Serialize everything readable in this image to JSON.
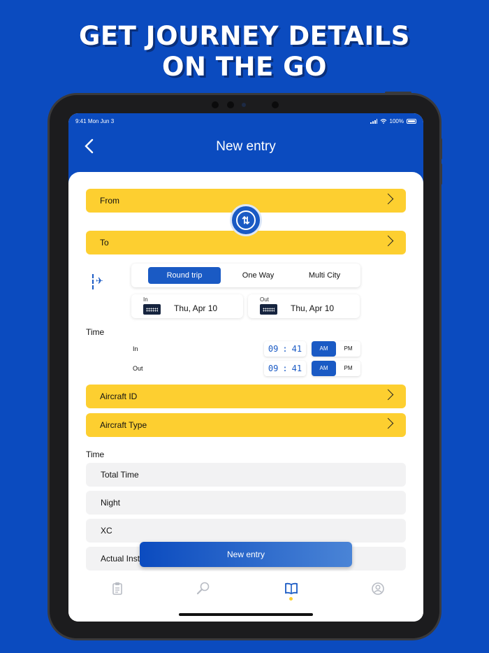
{
  "headline": {
    "line1": "GET JOURNEY DETAILS",
    "line2": "ON THE GO"
  },
  "status_bar": {
    "time": "9:41",
    "date": "Mon Jun 3",
    "battery": "100%"
  },
  "nav": {
    "title": "New entry",
    "back_icon": "chevron-left-icon"
  },
  "route": {
    "from_label": "From",
    "to_label": "To",
    "swap_icon": "swap-arrows-icon",
    "plane_icon": "plane-icon"
  },
  "trip_type": {
    "options": [
      "Round trip",
      "One Way",
      "Multi City"
    ],
    "selected": "Round trip"
  },
  "dates": {
    "in_label": "In",
    "in_value": "Thu, Apr 10",
    "out_label": "Out",
    "out_value": "Thu, Apr 10"
  },
  "time_section": {
    "label": "Time",
    "in_label": "In",
    "in_hour": "09",
    "in_minute": "41",
    "out_label": "Out",
    "out_hour": "09",
    "out_minute": "41",
    "separator": ":",
    "am": "AM",
    "pm": "PM",
    "in_period": "AM",
    "out_period": "AM"
  },
  "aircraft": {
    "id_label": "Aircraft ID",
    "type_label": "Aircraft Type"
  },
  "time_totals": {
    "label": "Time",
    "rows": [
      "Total Time",
      "Night",
      "XC",
      "Actual Inst"
    ]
  },
  "fab_label": "New entry",
  "tabs": [
    {
      "name": "logbook-tab",
      "icon": "clipboard-icon"
    },
    {
      "name": "search-tab",
      "icon": "magnifier-icon"
    },
    {
      "name": "entries-tab",
      "icon": "book-icon",
      "active": true
    },
    {
      "name": "profile-tab",
      "icon": "user-circle-icon"
    }
  ],
  "colors": {
    "brand_blue": "#0b4bbf",
    "accent_yellow": "#fdcf30",
    "field_gray": "#f2f2f3"
  }
}
